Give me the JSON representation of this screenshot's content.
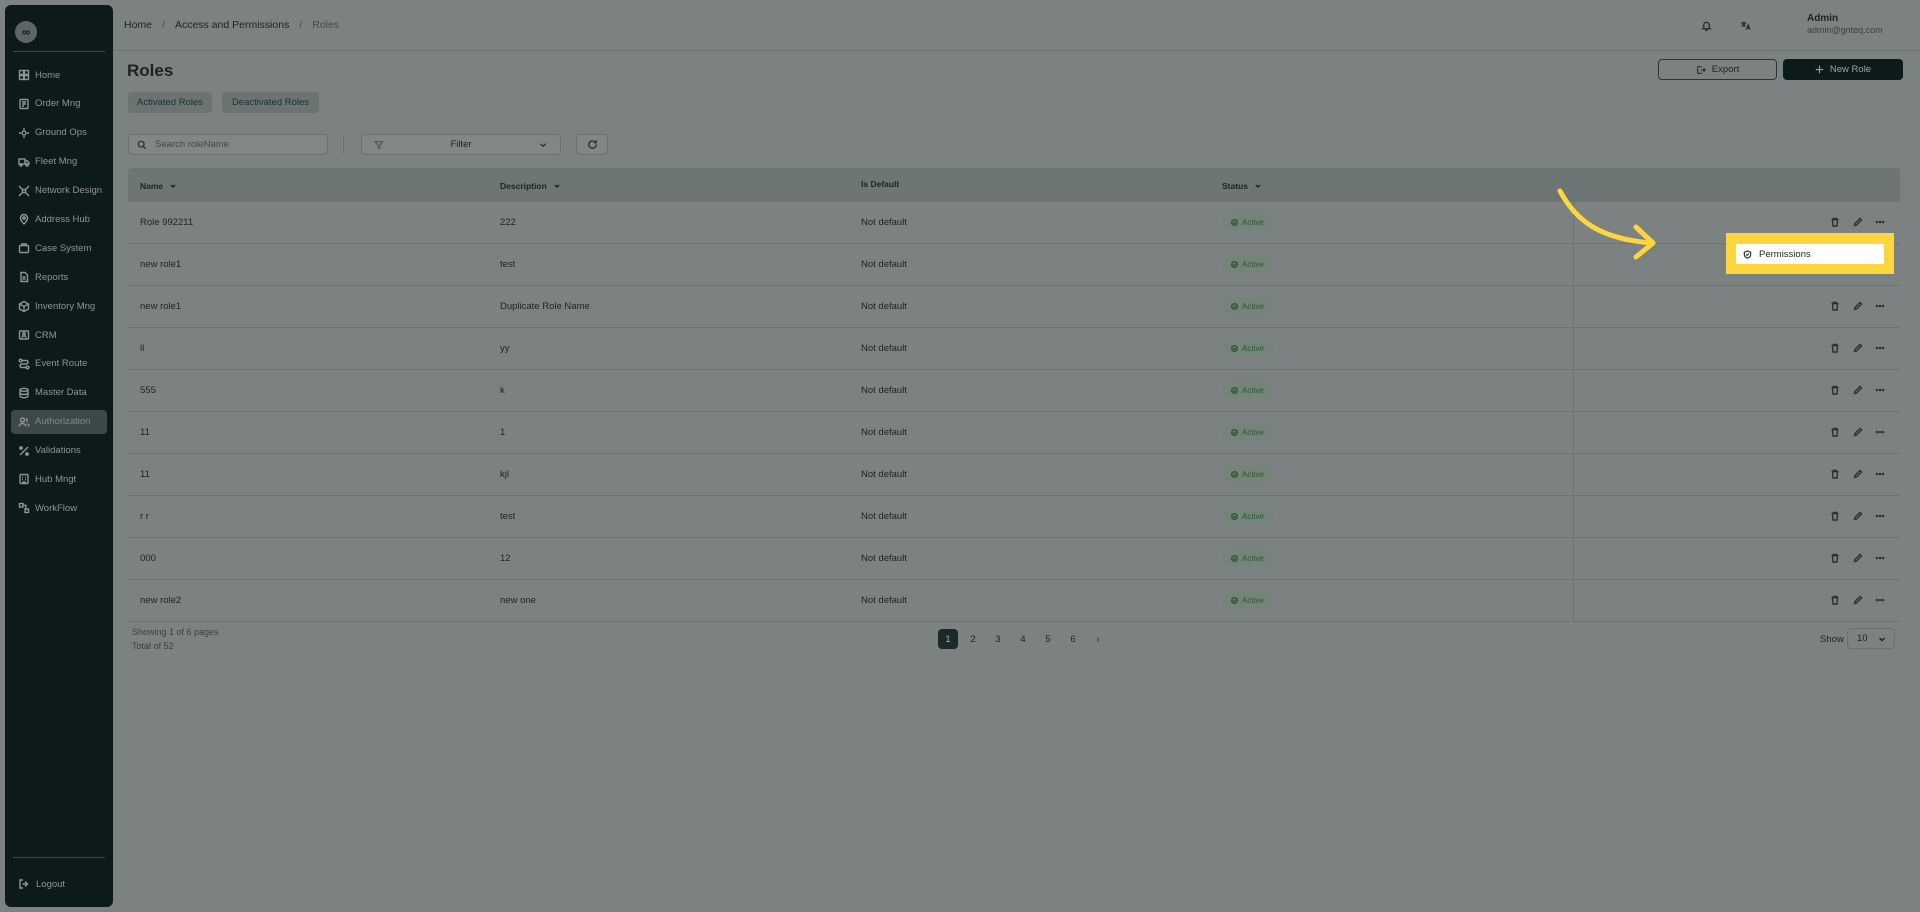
{
  "app": {
    "logo_text": "∞"
  },
  "sidebar": {
    "items": [
      {
        "label": "Home",
        "icon": "grid-icon"
      },
      {
        "label": "Order Mng",
        "icon": "order-icon"
      },
      {
        "label": "Ground Ops",
        "icon": "ops-icon"
      },
      {
        "label": "Fleet Mng",
        "icon": "truck-icon"
      },
      {
        "label": "Network Design",
        "icon": "network-icon"
      },
      {
        "label": "Address Hub",
        "icon": "map-pin-icon"
      },
      {
        "label": "Case System",
        "icon": "case-icon"
      },
      {
        "label": "Reports",
        "icon": "report-icon"
      },
      {
        "label": "Inventory Mng",
        "icon": "inventory-icon"
      },
      {
        "label": "CRM",
        "icon": "crm-icon"
      },
      {
        "label": "Event Route",
        "icon": "route-icon"
      },
      {
        "label": "Master Data",
        "icon": "database-icon"
      },
      {
        "label": "Authorization",
        "icon": "users-icon",
        "active": true
      },
      {
        "label": "Validations",
        "icon": "validation-icon"
      },
      {
        "label": "Hub Mngt",
        "icon": "hub-icon"
      },
      {
        "label": "WorkFlow",
        "icon": "workflow-icon"
      }
    ],
    "logout_label": "Logout"
  },
  "header": {
    "breadcrumb": [
      "Home",
      "Access and Permissions",
      "Roles"
    ],
    "user_name": "Admin",
    "user_email": "admin@gnteq.com"
  },
  "page": {
    "title": "Roles",
    "export_label": "Export",
    "new_role_label": "New Role",
    "tabs": [
      "Activated Roles",
      "Deactivated Roles"
    ]
  },
  "toolbar": {
    "search_placeholder": "Search roleName",
    "filter_label": "Filter"
  },
  "table": {
    "columns": [
      "Name",
      "Description",
      "Is Default",
      "Status"
    ],
    "rows": [
      {
        "name": "Role 992211",
        "description": "222",
        "is_default": "Not default",
        "status": "Active"
      },
      {
        "name": "new role1",
        "description": "test",
        "is_default": "Not default",
        "status": "Active"
      },
      {
        "name": "new role1",
        "description": "Duplicate Role Name",
        "is_default": "Not default",
        "status": "Active"
      },
      {
        "name": "ll",
        "description": "yy",
        "is_default": "Not default",
        "status": "Active"
      },
      {
        "name": "555",
        "description": "k",
        "is_default": "Not default",
        "status": "Active"
      },
      {
        "name": "11",
        "description": "1",
        "is_default": "Not default",
        "status": "Active"
      },
      {
        "name": "11",
        "description": "kjl",
        "is_default": "Not default",
        "status": "Active"
      },
      {
        "name": "r r",
        "description": "test",
        "is_default": "Not default",
        "status": "Active"
      },
      {
        "name": "000",
        "description": "12",
        "is_default": "Not default",
        "status": "Active"
      },
      {
        "name": "new role2",
        "description": "new one",
        "is_default": "Not default",
        "status": "Active"
      }
    ]
  },
  "pagination": {
    "showing_text": "Showing 1 of 6 pages",
    "total_text": "Total of 52",
    "pages": [
      "1",
      "2",
      "3",
      "4",
      "5",
      "6"
    ],
    "current_page": "1",
    "next_symbol": "›",
    "show_label": "Show",
    "page_size": "10"
  },
  "dropdown": {
    "items": [
      "Permissions"
    ]
  },
  "colors": {
    "highlight": "#fcd53f",
    "sidebar_bg": "#0c1a1a",
    "overlay_bg": "#7b8281",
    "status_active": "#2d5437"
  }
}
